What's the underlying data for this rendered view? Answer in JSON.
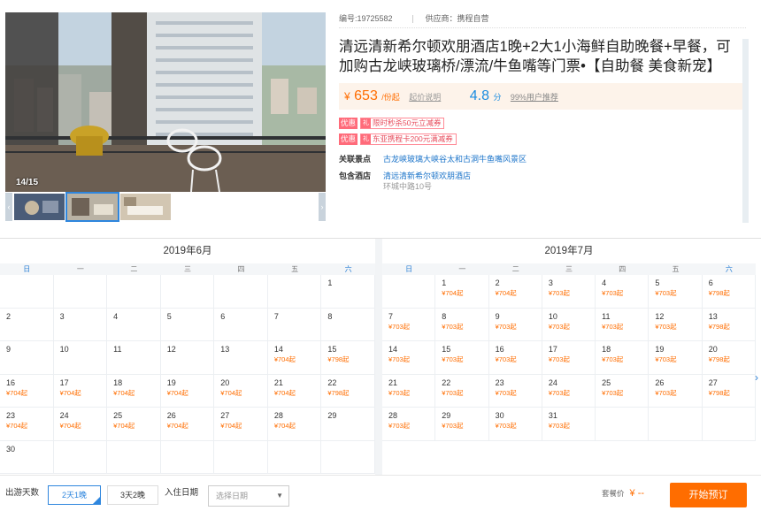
{
  "gallery": {
    "counter": "14/15",
    "prev_label": "‹",
    "next_label": "›"
  },
  "product": {
    "id_text": "编号:19725582",
    "supplier_text": "供应商：携程自营",
    "title": "清远清新希尔顿欢朋酒店1晚+2大1小海鲜自助晚餐+早餐，可加购古龙峡玻璃桥/漂流/牛鱼嘴等门票•【自助餐 美食新宠】",
    "price_symbol": "¥",
    "price": "653",
    "price_unit": "/份起",
    "price_note": "起价说明",
    "score": "4.8",
    "score_unit": "分",
    "recommend": "99%用户推荐",
    "promos": [
      {
        "tag": "优惠",
        "text": "限时秒杀50元立减券"
      },
      {
        "tag": "优惠",
        "text": "东亚携程卡200元满减券"
      }
    ],
    "attractions_label": "关联景点",
    "attractions_value": "古龙峡玻璃大峡谷太和古洞牛鱼嘴风景区",
    "hotel_label": "包含酒店",
    "hotel_value": "清远清新希尔顿欢朋酒店",
    "hotel_addr": "环城中路10号"
  },
  "weekdays": [
    "日",
    "一",
    "二",
    "三",
    "四",
    "五",
    "六"
  ],
  "calendars": [
    {
      "title": "2019年6月",
      "offset": 6,
      "days": [
        {
          "d": "1",
          "p": ""
        },
        {
          "d": "2",
          "p": ""
        },
        {
          "d": "3",
          "p": ""
        },
        {
          "d": "4",
          "p": ""
        },
        {
          "d": "5",
          "p": ""
        },
        {
          "d": "6",
          "p": ""
        },
        {
          "d": "7",
          "p": ""
        },
        {
          "d": "8",
          "p": ""
        },
        {
          "d": "9",
          "p": ""
        },
        {
          "d": "10",
          "p": ""
        },
        {
          "d": "11",
          "p": ""
        },
        {
          "d": "12",
          "p": ""
        },
        {
          "d": "13",
          "p": ""
        },
        {
          "d": "14",
          "p": "¥704起"
        },
        {
          "d": "15",
          "p": "¥798起"
        },
        {
          "d": "16",
          "p": "¥704起"
        },
        {
          "d": "17",
          "p": "¥704起"
        },
        {
          "d": "18",
          "p": "¥704起"
        },
        {
          "d": "19",
          "p": "¥704起"
        },
        {
          "d": "20",
          "p": "¥704起"
        },
        {
          "d": "21",
          "p": "¥704起"
        },
        {
          "d": "22",
          "p": "¥798起"
        },
        {
          "d": "23",
          "p": "¥704起"
        },
        {
          "d": "24",
          "p": "¥704起"
        },
        {
          "d": "25",
          "p": "¥704起"
        },
        {
          "d": "26",
          "p": "¥704起"
        },
        {
          "d": "27",
          "p": "¥704起"
        },
        {
          "d": "28",
          "p": "¥704起"
        },
        {
          "d": "29",
          "p": ""
        },
        {
          "d": "30",
          "p": ""
        }
      ]
    },
    {
      "title": "2019年7月",
      "offset": 1,
      "days": [
        {
          "d": "1",
          "p": "¥704起"
        },
        {
          "d": "2",
          "p": "¥704起"
        },
        {
          "d": "3",
          "p": "¥703起"
        },
        {
          "d": "4",
          "p": "¥703起"
        },
        {
          "d": "5",
          "p": "¥703起"
        },
        {
          "d": "6",
          "p": "¥798起"
        },
        {
          "d": "7",
          "p": "¥703起"
        },
        {
          "d": "8",
          "p": "¥703起"
        },
        {
          "d": "9",
          "p": "¥703起"
        },
        {
          "d": "10",
          "p": "¥703起"
        },
        {
          "d": "11",
          "p": "¥703起"
        },
        {
          "d": "12",
          "p": "¥703起"
        },
        {
          "d": "13",
          "p": "¥798起"
        },
        {
          "d": "14",
          "p": "¥703起"
        },
        {
          "d": "15",
          "p": "¥703起"
        },
        {
          "d": "16",
          "p": "¥703起"
        },
        {
          "d": "17",
          "p": "¥703起"
        },
        {
          "d": "18",
          "p": "¥703起"
        },
        {
          "d": "19",
          "p": "¥703起"
        },
        {
          "d": "20",
          "p": "¥798起"
        },
        {
          "d": "21",
          "p": "¥703起"
        },
        {
          "d": "22",
          "p": "¥703起"
        },
        {
          "d": "23",
          "p": "¥703起"
        },
        {
          "d": "24",
          "p": "¥703起"
        },
        {
          "d": "25",
          "p": "¥703起"
        },
        {
          "d": "26",
          "p": "¥703起"
        },
        {
          "d": "27",
          "p": "¥798起"
        },
        {
          "d": "28",
          "p": "¥703起"
        },
        {
          "d": "29",
          "p": "¥703起"
        },
        {
          "d": "30",
          "p": "¥703起"
        },
        {
          "d": "31",
          "p": "¥703起"
        }
      ]
    }
  ],
  "booking": {
    "days_label": "出游天数",
    "option1": "2天1晚",
    "option2": "3天2晚",
    "checkin_label": "入住日期",
    "date_placeholder": "选择日期",
    "pkg_label": "套餐价",
    "pkg_value": "¥ --",
    "book_label": "开始预订"
  },
  "colors": {
    "accent": "#ff6d00",
    "link": "#1a73c9",
    "weekend": "#2a7fd4"
  }
}
